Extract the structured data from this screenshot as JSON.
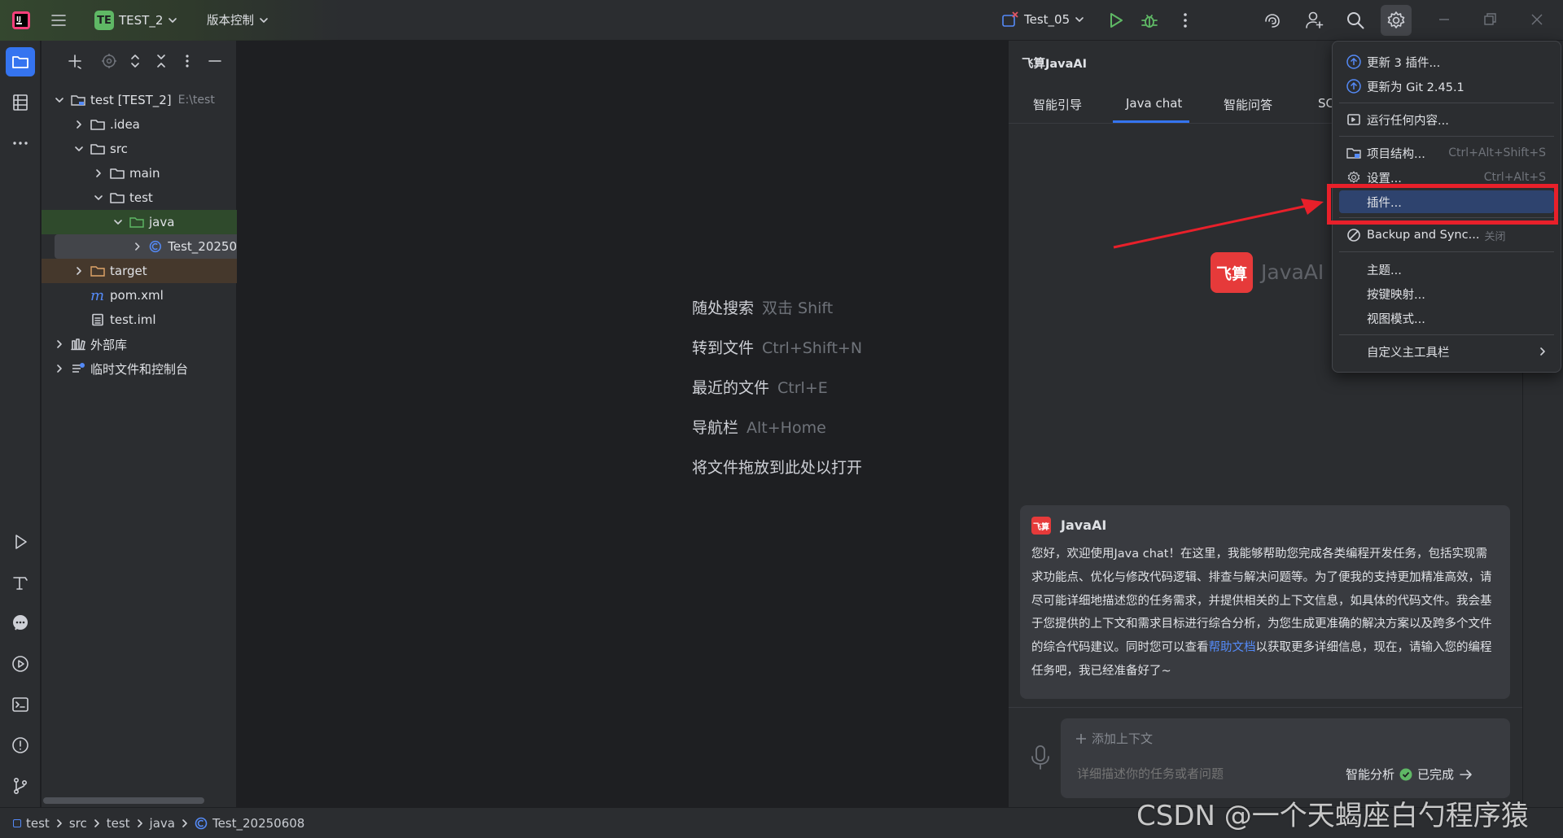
{
  "title_bar": {
    "project_badge": "TE",
    "project_name": "TEST_2",
    "vcs_label": "版本控制",
    "run_config": "Test_05"
  },
  "project_tree": [
    {
      "label": "test [TEST_2]",
      "path": "E:\\test"
    },
    {
      "label": ".idea"
    },
    {
      "label": "src"
    },
    {
      "label": "main"
    },
    {
      "label": "test"
    },
    {
      "label": "java"
    },
    {
      "label": "Test_20250"
    },
    {
      "label": "target"
    },
    {
      "label": "pom.xml"
    },
    {
      "label": "test.iml"
    },
    {
      "label": "外部库"
    },
    {
      "label": "临时文件和控制台"
    }
  ],
  "editor_hints": [
    {
      "action": "随处搜索",
      "key": "双击 Shift"
    },
    {
      "action": "转到文件",
      "key": "Ctrl+Shift+N"
    },
    {
      "action": "最近的文件",
      "key": "Ctrl+E"
    },
    {
      "action": "导航栏",
      "key": "Alt+Home"
    },
    {
      "action": "将文件拖放到此处以打开",
      "key": ""
    }
  ],
  "ai_panel": {
    "title": "飞算JavaAI",
    "tabs": [
      "智能引导",
      "Java chat",
      "智能问答",
      "SC"
    ],
    "logo_glyph": "飞算",
    "logo_text": "JavaAI",
    "message_sender": "JavaAI",
    "message_text": "您好，欢迎使用Java chat！在这里，我能够帮助您完成各类编程开发任务，包括实现需求功能点、优化与修改代码逻辑、排查与解决问题等。为了便我的支持更加精准高效，请尽可能详细地描述您的任务需求，并提供相关的上下文信息，如具体的代码文件。我会基于您提供的上下文和需求目标进行综合分析，为您生成更准确的解决方案以及跨多个文件的综合代码建议。同时您可以查看",
    "message_link": "帮助文档",
    "message_tail": "以获取更多详细信息，现在，请输入您的编程任务吧，我已经准备好了~",
    "add_context": "添加上下文",
    "input_placeholder": "详细描述你的任务或者问题",
    "mode_label": "智能分析",
    "status_label": "已完成"
  },
  "settings_menu": {
    "items": [
      {
        "label": "更新 3 插件...",
        "shortcut": ""
      },
      {
        "label": "更新为 Git 2.45.1",
        "shortcut": ""
      },
      {
        "label": "运行任何内容...",
        "shortcut": ""
      },
      {
        "label": "项目结构...",
        "shortcut": "Ctrl+Alt+Shift+S"
      },
      {
        "label": "设置...",
        "shortcut": "Ctrl+Alt+S"
      },
      {
        "label": "插件...",
        "shortcut": ""
      },
      {
        "label": "Backup and Sync...",
        "shortcut": "关闭"
      },
      {
        "label": "主题...",
        "shortcut": ""
      },
      {
        "label": "按键映射...",
        "shortcut": ""
      },
      {
        "label": "视图模式...",
        "shortcut": ""
      },
      {
        "label": "自定义主工具栏",
        "shortcut": ""
      }
    ],
    "highlighted_item": "插件..."
  },
  "status_bar": {
    "breadcrumbs": [
      "test",
      "src",
      "test",
      "java",
      "Test_20250608"
    ]
  },
  "watermark": "CSDN @一个天蝎座白勺程序猿",
  "colors": {
    "accent_blue": "#3574f0",
    "highlight_red": "#e8202a",
    "brand_red": "#e63a3a",
    "success_green": "#5fb865"
  }
}
